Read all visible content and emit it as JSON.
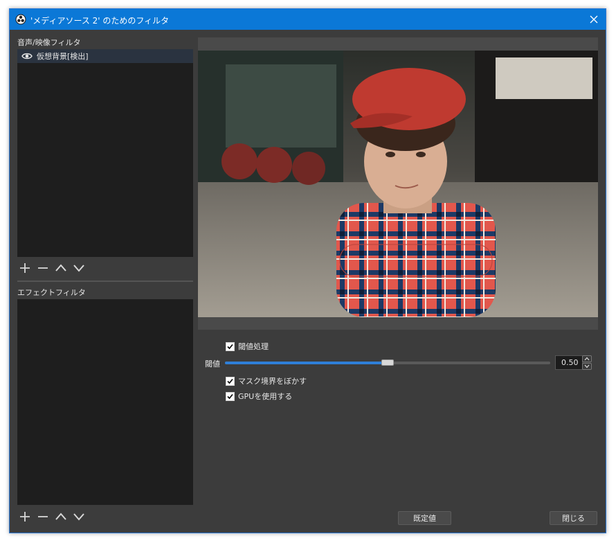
{
  "window": {
    "title": "'メディアソース 2' のためのフィルタ"
  },
  "audio_video_filters": {
    "label": "音声/映像フィルタ",
    "items": [
      {
        "label": "仮想背景[検出]",
        "visible": true
      }
    ]
  },
  "effect_filters": {
    "label": "エフェクトフィルタ",
    "items": []
  },
  "settings": {
    "threshold_checkbox": {
      "label": "閾値処理",
      "checked": true
    },
    "threshold": {
      "label": "閾値",
      "value": "0.50",
      "fraction": 0.5
    },
    "blur_mask_checkbox": {
      "label": "マスク境界をぼかす",
      "checked": true
    },
    "gpu_checkbox": {
      "label": "GPUを使用する",
      "checked": true
    }
  },
  "buttons": {
    "defaults": "既定値",
    "close": "閉じる"
  },
  "colors": {
    "titlebar": "#0b78d7",
    "accent": "#2f7fd8",
    "panel": "#3c3c3c",
    "list_bg": "#1e1e1e"
  },
  "icons": [
    "obs-icon",
    "close-icon",
    "eye-icon",
    "plus-icon",
    "minus-icon",
    "chevron-up-icon",
    "chevron-down-icon",
    "checkmark-icon"
  ]
}
